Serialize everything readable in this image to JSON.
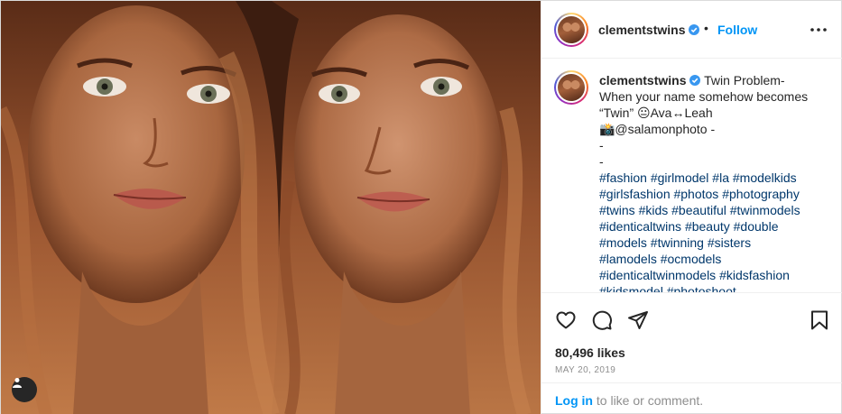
{
  "post": {
    "username": "clementstwins",
    "follow_label": "Follow",
    "separator": "•",
    "caption": {
      "username": "clementstwins",
      "lines": [
        "Twin Problem-",
        "When your name somehow becomes",
        "“Twin” 😐Ava↔Leah",
        "📸@salamonphoto -",
        "-",
        "-"
      ],
      "hashtag_lines": [
        "#fashion #girlmodel #la #modelkids",
        "#girlsfashion #photos #photography",
        "#twins #kids #beautiful #twinmodels",
        "#identicaltwins #beauty #double",
        "#models #twinning #sisters",
        "#lamodels #ocmodels",
        "#identicaltwinmodels #kidsfashion",
        "#kidsmodel #photoshoot"
      ]
    },
    "likes": "80,496 likes",
    "date": "MAY 20, 2019",
    "login_link": "Log in",
    "login_suffix": " to like or comment."
  },
  "colors": {
    "link_blue": "#0095f6",
    "hashtag": "#00376b",
    "text": "#262626",
    "muted": "#8e8e8e"
  },
  "icons": [
    "verified-badge-icon",
    "more-options-icon",
    "heart-icon",
    "comment-icon",
    "share-icon",
    "bookmark-icon",
    "user-tag-icon"
  ]
}
